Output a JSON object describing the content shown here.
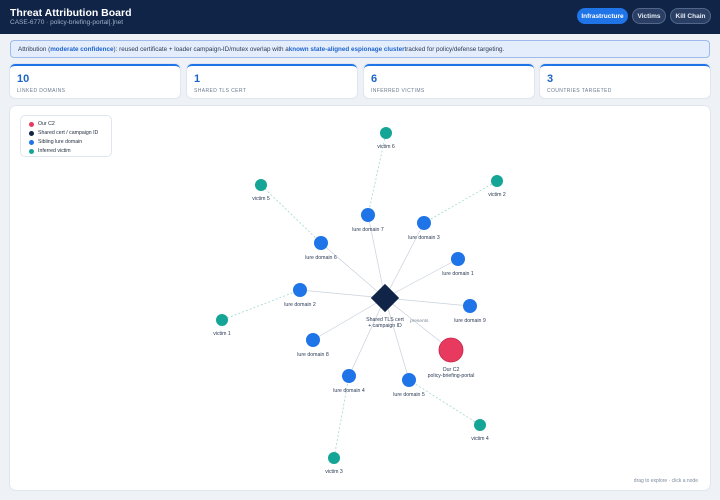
{
  "header": {
    "title": "Threat Attribution Board",
    "subtitle": "CASE-6770 · policy-briefing-portal[.]net",
    "tabs": [
      {
        "label": "Infrastructure",
        "active": true
      },
      {
        "label": "Victims",
        "active": false
      },
      {
        "label": "Kill Chain",
        "active": false
      }
    ]
  },
  "banner": {
    "prefix": "Attribution (",
    "confidence": "moderate confidence",
    "middle": "): reused certificate + loader campaign-ID/mutex overlap with a ",
    "cluster": "known state-aligned espionage cluster",
    "suffix": " tracked for policy/defense targeting."
  },
  "stats": [
    {
      "value": "10",
      "label": "LINKED DOMAINS"
    },
    {
      "value": "1",
      "label": "SHARED TLS CERT"
    },
    {
      "value": "6",
      "label": "INFERRED VICTIMS"
    },
    {
      "value": "3",
      "label": "COUNTRIES TARGETED"
    }
  ],
  "legend": [
    {
      "label": "Our C2",
      "color": "#e83a5e"
    },
    {
      "label": "Shared cert / campaign ID",
      "color": "#0f2447"
    },
    {
      "label": "Sibling lure domain",
      "color": "#1f74e8"
    },
    {
      "label": "Inferred victim",
      "color": "#14a596"
    }
  ],
  "graph": {
    "hint": "drag to explore · click a node",
    "edge_label": "presents",
    "hub": {
      "label_line1": "Shared TLS cert",
      "label_line2": "+ campaign ID"
    },
    "c2": {
      "label_line1": "Our C2",
      "label_line2": "policy-briefing-portal"
    },
    "domains": [
      "lure domain 1",
      "lure domain 2",
      "lure domain 3",
      "lure domain 4",
      "lure domain 5",
      "lure domain 6",
      "lure domain 7",
      "lure domain 8",
      "lure domain 9"
    ],
    "victims": [
      "victim 1",
      "victim 2",
      "victim 3",
      "victim 4",
      "victim 5",
      "victim 6"
    ]
  }
}
